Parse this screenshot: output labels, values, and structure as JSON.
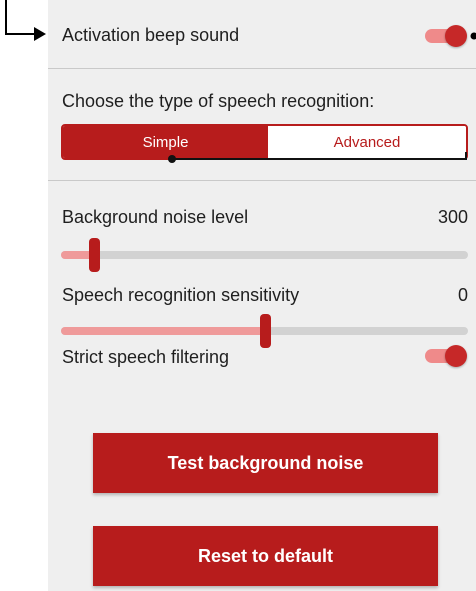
{
  "settings": {
    "activation_beep": {
      "label": "Activation beep sound",
      "enabled": true
    },
    "recognition_type": {
      "label": "Choose the type of speech recognition:",
      "options": [
        "Simple",
        "Advanced"
      ],
      "selected": "Simple"
    },
    "background_noise": {
      "label": "Background noise level",
      "value": "300",
      "slider_fraction": 0.08
    },
    "sensitivity": {
      "label": "Speech recognition sensitivity",
      "value": "0",
      "slider_fraction": 0.5
    },
    "strict_filtering": {
      "label": "Strict speech filtering",
      "enabled": true
    }
  },
  "buttons": {
    "test_noise": "Test background noise",
    "reset": "Reset to default"
  },
  "colors": {
    "accent": "#b71c1c",
    "accent_light": "#ef9a9a",
    "panel_bg": "#efefef"
  }
}
